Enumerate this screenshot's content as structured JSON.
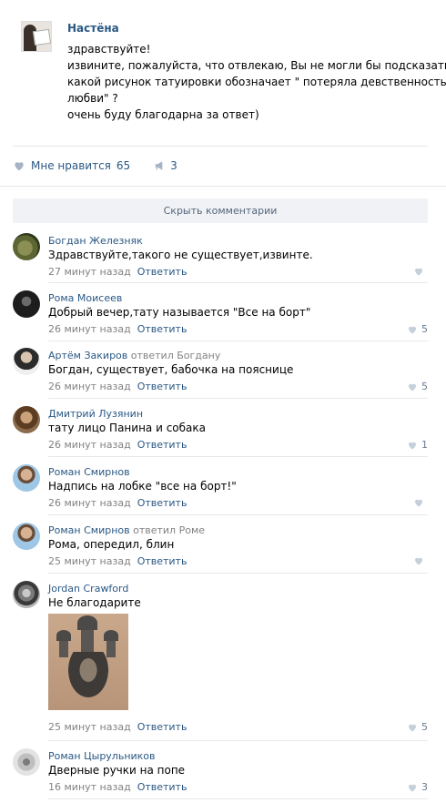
{
  "post": {
    "author": "Настёна",
    "lines": [
      "здравствуйте!",
      "извините, пожалуйста, что отвлекаю, Вы не могли бы подсказать,",
      "какой рисунок татуировки обозначает \" потеряла девственность по",
      "любви\" ?",
      "очень буду благодарна за ответ)"
    ],
    "likes_label": "Мне нравится",
    "likes_count": "65",
    "reposts_count": "3"
  },
  "hide_comments_label": "Скрыть комментарии",
  "reply_label": "Ответить",
  "comments": [
    {
      "author": "Богдан Железняк",
      "reply_to": "",
      "text": "Здравствуйте,такого не существует,извинте.",
      "time": "27 минут назад",
      "likes": ""
    },
    {
      "author": "Рома Моисеев",
      "reply_to": "",
      "text": "Добрый вечер,тату называется \"Все на борт\"",
      "time": "26 минут назад",
      "likes": "5"
    },
    {
      "author": "Артём Закиров",
      "reply_to": "ответил Богдану",
      "text": "Богдан, существует, бабочка на пояснице",
      "time": "26 минут назад",
      "likes": "5"
    },
    {
      "author": "Дмитрий Лузянин",
      "reply_to": "",
      "text": "тату лицо Панина и собака",
      "time": "26 минут назад",
      "likes": "1"
    },
    {
      "author": "Роман Смирнов",
      "reply_to": "",
      "text": "Надпись на лобке \"все на борт!\"",
      "time": "26 минут назад",
      "likes": ""
    },
    {
      "author": "Роман Смирнов",
      "reply_to": "ответил Роме",
      "text": "Рома, опередил, блин",
      "time": "25 минут назад",
      "likes": ""
    },
    {
      "author": "Jordan Crawford",
      "reply_to": "",
      "text": "Не благодарите",
      "time": "25 минут назад",
      "likes": "5"
    },
    {
      "author": "Роман Цырульников",
      "reply_to": "",
      "text": "Дверные ручки на попе",
      "time": "16 минут назад",
      "likes": "3"
    }
  ],
  "colors": {
    "link": "#2a5885",
    "meta": "#828282",
    "separator": "#e7e8ec",
    "button_bg": "#f0f2f5",
    "like_icon": "#a6b4c5"
  },
  "icons": {
    "like": "heart-icon",
    "repost": "megaphone-icon"
  }
}
